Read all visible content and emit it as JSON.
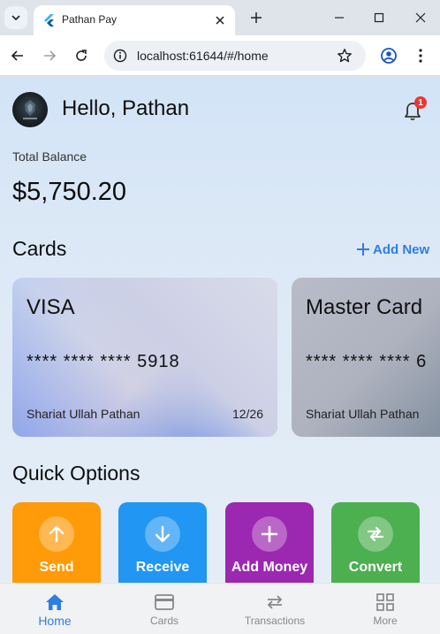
{
  "browser": {
    "tab_title": "Pathan Pay",
    "url": "localhost:61644/#/home"
  },
  "header": {
    "greeting": "Hello, Pathan",
    "notification_count": "1"
  },
  "balance": {
    "label": "Total Balance",
    "value": "$5,750.20"
  },
  "cards_section": {
    "title": "Cards",
    "add_new_label": "Add New",
    "cards": [
      {
        "name": "VISA",
        "number": "**** **** **** 5918",
        "holder": "Shariat Ullah Pathan",
        "expiry": "12/26"
      },
      {
        "name": "Master Card",
        "number": "**** **** **** 6",
        "holder": "Shariat Ullah Pathan",
        "expiry": ""
      }
    ]
  },
  "quick_options": {
    "title": "Quick Options",
    "items": [
      {
        "label": "Send",
        "color": "#ff9a08",
        "icon": "arrow-up-icon"
      },
      {
        "label": "Receive",
        "color": "#2196f3",
        "icon": "arrow-down-icon"
      },
      {
        "label": "Add Money",
        "color": "#9c27b0",
        "icon": "plus-icon"
      },
      {
        "label": "Convert",
        "color": "#4caf50",
        "icon": "swap-icon"
      }
    ]
  },
  "bottom_nav": {
    "items": [
      {
        "label": "Home",
        "icon": "home-icon",
        "active": true
      },
      {
        "label": "Cards",
        "icon": "card-icon",
        "active": false
      },
      {
        "label": "Transactions",
        "icon": "swap-icon",
        "active": false
      },
      {
        "label": "More",
        "icon": "grid-icon",
        "active": false
      }
    ]
  },
  "colors": {
    "accent": "#2f7ee0",
    "badge": "#e53935"
  }
}
